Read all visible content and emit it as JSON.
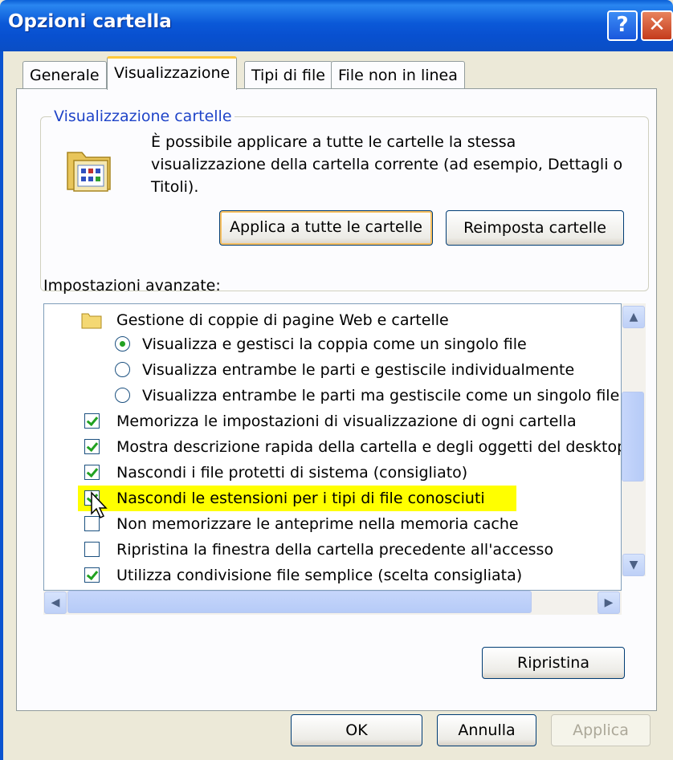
{
  "window": {
    "title": "Opzioni cartella",
    "help_label": "?",
    "close_label": "✕"
  },
  "tabs": [
    {
      "label": "Generale"
    },
    {
      "label": "Visualizzazione"
    },
    {
      "label": "Tipi di file"
    },
    {
      "label": "File non in linea"
    }
  ],
  "folder_views": {
    "title": "Visualizzazione cartelle",
    "description": "È possibile applicare a tutte le cartelle la stessa visualizzazione della cartella corrente (ad esempio, Dettagli o Titoli).",
    "apply_all_label": "Applica a tutte le cartelle",
    "reset_label": "Reimposta cartelle",
    "icon": "folder-view-icon"
  },
  "advanced": {
    "label": "Impostazioni avanzate:",
    "items": [
      {
        "type": "folder",
        "label": "Gestione di coppie di pagine Web e cartelle"
      },
      {
        "type": "radio",
        "checked": true,
        "label": "Visualizza e gestisci la coppia come un singolo file"
      },
      {
        "type": "radio",
        "checked": false,
        "label": "Visualizza entrambe le parti e gestiscile individualmente"
      },
      {
        "type": "radio",
        "checked": false,
        "label": "Visualizza entrambe le parti ma gestiscile come un singolo file"
      },
      {
        "type": "check",
        "checked": true,
        "label": "Memorizza le impostazioni di visualizzazione di ogni cartella"
      },
      {
        "type": "check",
        "checked": true,
        "label": "Mostra descrizione rapida della cartella e degli oggetti del desktop"
      },
      {
        "type": "check",
        "checked": true,
        "label": "Nascondi i file protetti di sistema (consigliato)"
      },
      {
        "type": "check",
        "checked": true,
        "label": "Nascondi le estensioni per i tipi di file conosciuti",
        "highlight": "#ffff00"
      },
      {
        "type": "check",
        "checked": false,
        "label": "Non memorizzare le anteprime nella memoria cache"
      },
      {
        "type": "check",
        "checked": false,
        "label": "Ripristina la finestra della cartella precedente all'accesso"
      },
      {
        "type": "check",
        "checked": true,
        "label": "Utilizza condivisione file semplice (scelta consigliata)"
      }
    ]
  },
  "buttons": {
    "ripristina": "Ripristina",
    "ok": "OK",
    "annulla": "Annulla",
    "applica": "Applica"
  },
  "colors": {
    "titlebar": "#0a5fd6",
    "highlight": "#ffff00",
    "check": "#21a121",
    "group_title": "#1f44c8"
  }
}
